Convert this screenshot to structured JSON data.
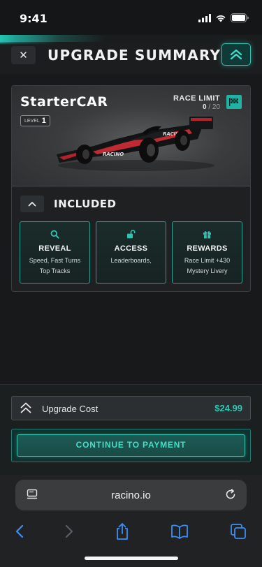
{
  "status_bar": {
    "time": "9:41"
  },
  "header": {
    "title": "UPGRADE SUMMARY",
    "close_label": "✕"
  },
  "car": {
    "name": "StarterCAR",
    "level_label": "LEVEL",
    "level": "1",
    "race_limit_label": "RACE LIMIT",
    "race_limit_current": "0",
    "race_limit_max": "/ 20",
    "livery_text_top": "RACINO",
    "livery_text_wing": "RACINO"
  },
  "included": {
    "label": "INCLUDED",
    "features": [
      {
        "title": "REVEAL",
        "desc_line1": "Speed, Fast Turns",
        "desc_line2": "Top Tracks",
        "icon": "search-icon"
      },
      {
        "title": "ACCESS",
        "desc_line1": "Leaderboards,",
        "desc_line2": "",
        "icon": "unlock-icon"
      },
      {
        "title": "REWARDS",
        "desc_line1": "Race Limit +430",
        "desc_line2": "Mystery Livery",
        "icon": "gift-icon"
      }
    ]
  },
  "checkout": {
    "cost_label": "Upgrade Cost",
    "cost_value": "$24.99",
    "pay_label": "CONTINUE TO PAYMENT"
  },
  "browser": {
    "url": "racino.io"
  },
  "colors": {
    "accent": "#2ec6b3",
    "background": "#17191a",
    "card": "#1e2022",
    "ios_blue": "#3d8ff5"
  }
}
